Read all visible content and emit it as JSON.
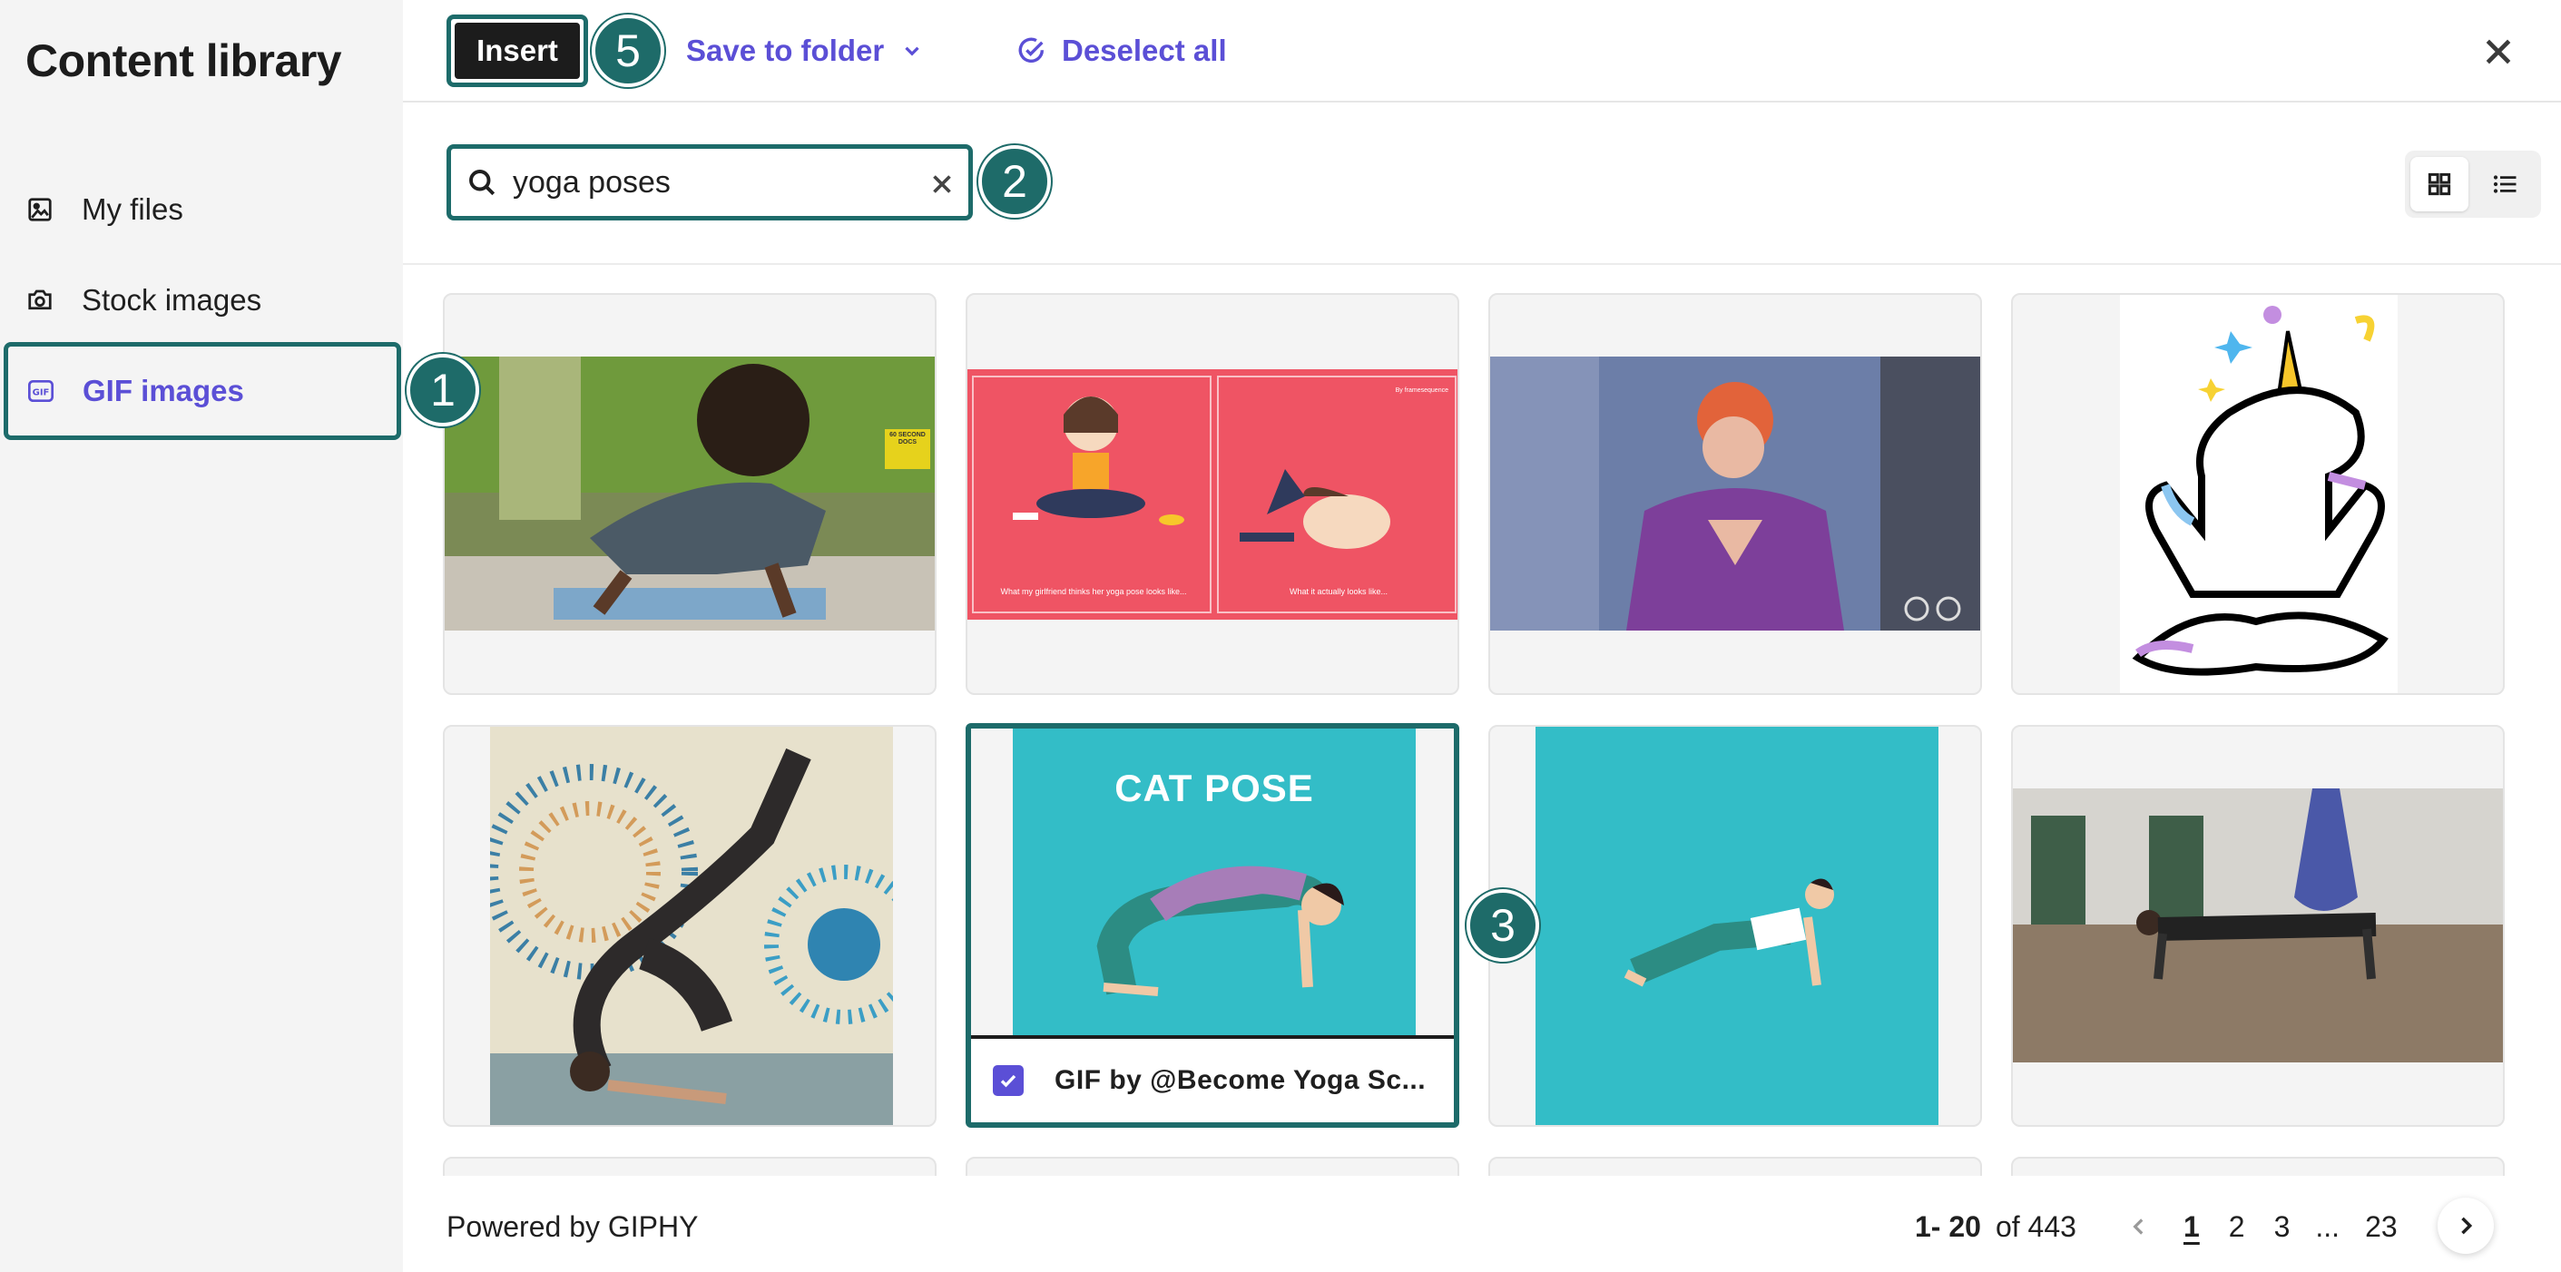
{
  "sidebar": {
    "title": "Content library",
    "items": [
      {
        "label": "My files",
        "icon": "image-icon"
      },
      {
        "label": "Stock images",
        "icon": "camera-icon"
      },
      {
        "label": "GIF images",
        "icon": "gif-icon"
      }
    ],
    "active_index": 2
  },
  "toolbar": {
    "insert_label": "Insert",
    "save_label": "Save to folder",
    "deselect_label": "Deselect all"
  },
  "search": {
    "value": "yoga poses"
  },
  "badges": {
    "sidebar_gif": "1",
    "search": "2",
    "grid": "3",
    "insert": "5"
  },
  "grid": {
    "items": [
      {
        "description": "yoga gif 1"
      },
      {
        "description": "yoga gif 2"
      },
      {
        "description": "yoga gif 3"
      },
      {
        "description": "yoga gif 4"
      },
      {
        "description": "yoga gif 5"
      },
      {
        "description": "yoga gif 6",
        "selected": true,
        "overlay_text": "CAT POSE"
      },
      {
        "description": "yoga gif 7"
      },
      {
        "description": "yoga gif 8"
      }
    ],
    "selected_caption": "GIF by @Become Yoga Sc..."
  },
  "thumb_texts": {
    "panel_left": "What my girlfriend thinks her yoga pose looks like...",
    "panel_right": "What it actually looks like...",
    "docs_logo": "60 SECOND DOCS",
    "frame_tag": "By framesequence"
  },
  "footer": {
    "powered": "Powered by GIPHY",
    "range": "1- 20",
    "of_total": "of 443",
    "pages": [
      "1",
      "2",
      "3",
      "...",
      "23"
    ],
    "current_page": "1"
  },
  "colors": {
    "accent": "#5b4fd6",
    "callout": "#1e6b69",
    "teal": "#33bdc7",
    "coral": "#ef5464"
  }
}
